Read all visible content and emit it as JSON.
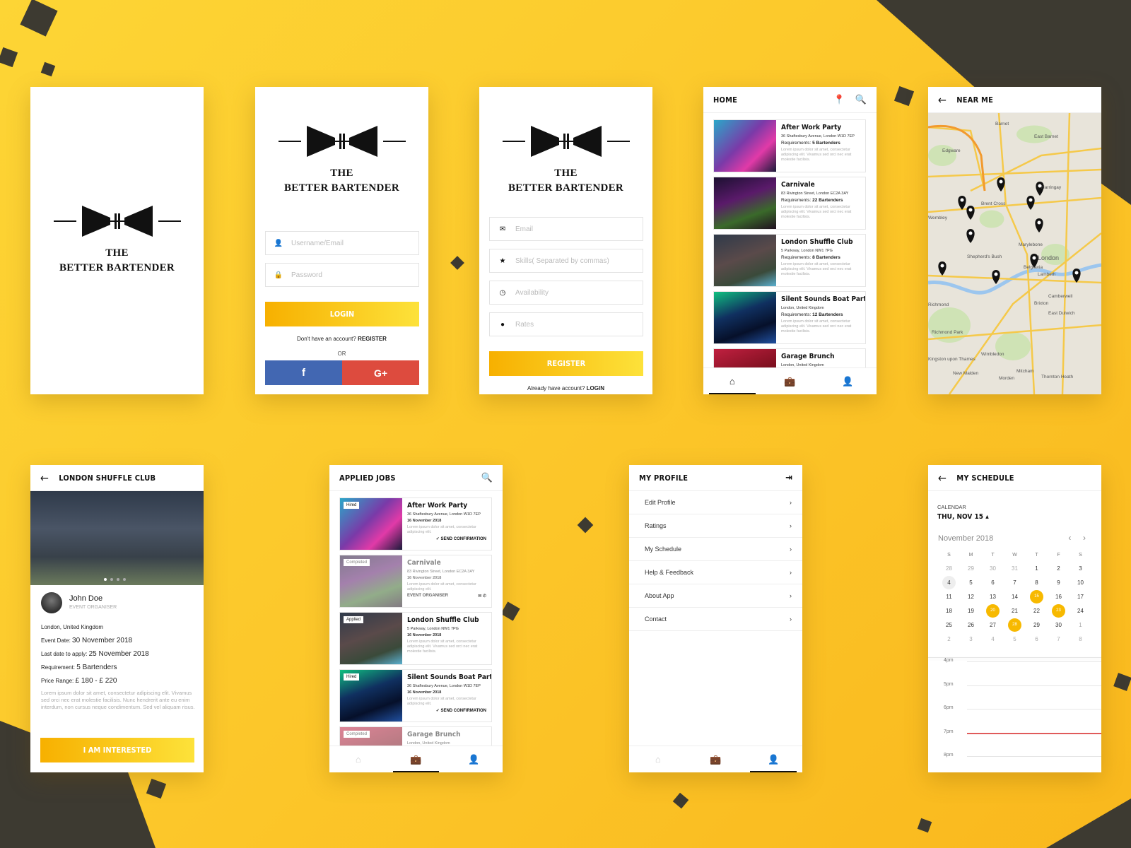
{
  "colors": {
    "accent": "#f7b000",
    "accent_light": "#fde23a",
    "dark": "#3d3a31",
    "facebook": "#4267b2",
    "google": "#dd4b3e",
    "now_line": "#e05b5b"
  },
  "brand": {
    "line1": "THE",
    "line2": "BETTER BARTENDER"
  },
  "login": {
    "username_placeholder": "Username/Email",
    "password_placeholder": "Password",
    "login_label": "LOGIN",
    "no_account": "Don't have an account?",
    "register_link": "REGISTER",
    "or": "OR",
    "facebook_icon": "f",
    "google_icon": "G+"
  },
  "register": {
    "email_placeholder": "Email",
    "skills_placeholder": "Skills( Separated by commas)",
    "availability_placeholder": "Availability",
    "rates_placeholder": "Rates",
    "register_label": "REGISTER",
    "have_account": "Already have account?",
    "login_link": "LOGIN"
  },
  "home": {
    "title": "HOME",
    "cards": [
      {
        "title": "After Work Party",
        "address": "36 Shaftesbury Avenue, London W1D 7EP",
        "req_label": "Requirements:",
        "req": "5 Bartenders",
        "lorem": "Lorem ipsum dolor sit amet, consectetur adipiscing elit. Vivamus sed orci nec erat molestie facilisis."
      },
      {
        "title": "Carnivale",
        "address": "83 Rivington Street, London EC2A 3AY",
        "req_label": "Requirements:",
        "req": "22 Bartenders",
        "lorem": "Lorem ipsum dolor sit amet, consectetur adipiscing elit. Vivamus sed orci nec erat molestie facilisis."
      },
      {
        "title": "London Shuffle Club",
        "address": "5 Parkway, London NW1 7PG",
        "req_label": "Requirements:",
        "req": "8 Bartenders",
        "lorem": "Lorem ipsum dolor sit amet, consectetur adipiscing elit. Vivamus sed orci nec erat molestie facilisis."
      },
      {
        "title": "Silent Sounds Boat Party",
        "address": "London, United Kingdom",
        "req_label": "Requirements:",
        "req": "12 Bartenders",
        "lorem": "Lorem ipsum dolor sit amet, consectetur adipiscing elit. Vivamus sed orci nec erat molestie facilisis."
      },
      {
        "title": "Garage Brunch",
        "address": "London, United Kingdom",
        "req_label": "",
        "req": "",
        "lorem": ""
      }
    ]
  },
  "near_me": {
    "title": "NEAR ME",
    "places": [
      "Barnet",
      "East Barnet",
      "Edgware",
      "Brent Cross",
      "Wembley",
      "Harringay",
      "Marylebone",
      "London",
      "Shepherd's Bush",
      "Belgravia",
      "Lambeth",
      "Richmond",
      "Camberwell",
      "Brixton",
      "East Dulwich",
      "Richmond Park",
      "Wimbledon",
      "Mitcham",
      "Morden",
      "New Malden",
      "Thornton Heath",
      "Kingston upon Thames"
    ]
  },
  "details": {
    "title": "LONDON SHUFFLE CLUB",
    "name": "John Doe",
    "role": "EVENT ORGANISER",
    "location": "London, United Kingdom",
    "event_date_label": "Event Date:",
    "event_date": "30 November 2018",
    "last_date_label": "Last date to apply:",
    "last_date": "25 November 2018",
    "req_label": "Requirement:",
    "req": "5 Bartenders",
    "price_label": "Price Range:",
    "price": "£ 180 - £ 220",
    "lorem": "Lorem ipsum dolor sit amet, consectetur adipiscing elit. Vivamus sed orci nec erat molestie facilisis. Nunc hendrerit ante eu enim interdum, non cursus neque condimentum. Sed vel aliquam risus.",
    "button": "I AM INTERESTED"
  },
  "applied": {
    "title": "APPLIED JOBS",
    "confirm": "SEND CONFIRMATION",
    "organiser": "EVENT ORGANISER",
    "jobs": [
      {
        "badge": "Hired",
        "title": "After Work Party",
        "address": "36 Shaftesbury Avenue, London W1D 7EP",
        "date": "16 November 2018",
        "lorem": "Lorem ipsum dolor sit amet, consectetur adipiscing elit."
      },
      {
        "badge": "Completed",
        "title": "Carnivale",
        "address": "83 Rivington Street, London EC2A 3AY",
        "date": "16 November 2018",
        "lorem": "Lorem ipsum dolor sit amet, consectetur adipiscing elit."
      },
      {
        "badge": "Applied",
        "title": "London Shuffle Club",
        "address": "5 Parkway, London NW1 7PG",
        "date": "16 November 2018",
        "lorem": "Lorem ipsum dolor sit amet, consectetur adipiscing elit. Vivamus sed orci nec erat molestie facilisis."
      },
      {
        "badge": "Hired",
        "title": "Silent Sounds Boat Party",
        "address": "36 Shaftesbury Avenue, London W1D 7EP",
        "date": "16 November 2018",
        "lorem": "Lorem ipsum dolor sit amet, consectetur adipiscing elit."
      },
      {
        "badge": "Completed",
        "title": "Garage Brunch",
        "address": "London, United Kingdom",
        "date": "",
        "lorem": ""
      }
    ]
  },
  "profile": {
    "title": "MY PROFILE",
    "items": [
      "Edit Profile",
      "Ratings",
      "My Schedule",
      "Help & Feedback",
      "About App",
      "Contact"
    ]
  },
  "schedule": {
    "title": "MY SCHEDULE",
    "label": "CALENDAR",
    "selected": "THU, NOV 15",
    "month": "November 2018",
    "weekdays": [
      "S",
      "M",
      "T",
      "W",
      "T",
      "F",
      "S"
    ],
    "weeks": [
      [
        "28",
        "29",
        "30",
        "31",
        "1",
        "2",
        "3"
      ],
      [
        "4",
        "5",
        "6",
        "7",
        "8",
        "9",
        "10"
      ],
      [
        "11",
        "12",
        "13",
        "14",
        "15",
        "16",
        "17"
      ],
      [
        "18",
        "19",
        "20",
        "21",
        "22",
        "23",
        "24"
      ],
      [
        "25",
        "26",
        "27",
        "28",
        "29",
        "30",
        "1"
      ],
      [
        "2",
        "3",
        "4",
        "5",
        "6",
        "7",
        "8"
      ]
    ],
    "highlighted": [
      "15",
      "20",
      "23",
      "28"
    ],
    "today": "4",
    "hours": [
      "4pm",
      "5pm",
      "6pm",
      "7pm",
      "8pm"
    ],
    "current_hour": "7pm"
  }
}
